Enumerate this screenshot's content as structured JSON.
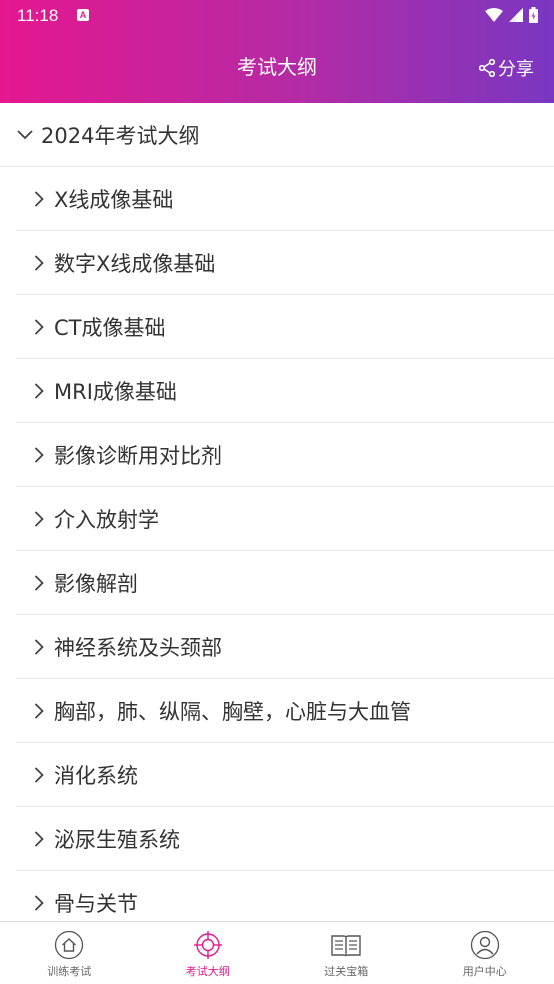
{
  "status": {
    "time": "11:18",
    "notif_icon": "A"
  },
  "header": {
    "title": "考试大纲",
    "share_label": "分享"
  },
  "section": {
    "title": "2024年考试大纲"
  },
  "items": [
    {
      "label": "X线成像基础"
    },
    {
      "label": "数字X线成像基础"
    },
    {
      "label": "CT成像基础"
    },
    {
      "label": "MRI成像基础"
    },
    {
      "label": "影像诊断用对比剂"
    },
    {
      "label": "介入放射学"
    },
    {
      "label": "影像解剖"
    },
    {
      "label": "神经系统及头颈部"
    },
    {
      "label": "胸部，肺、纵隔、胸壁，心脏与大血管"
    },
    {
      "label": "消化系统"
    },
    {
      "label": "泌尿生殖系统"
    },
    {
      "label": "骨与关节"
    }
  ],
  "nav": [
    {
      "label": "训练考试",
      "icon": "home-icon"
    },
    {
      "label": "考试大纲",
      "icon": "target-icon",
      "active": true
    },
    {
      "label": "过关宝箱",
      "icon": "book-icon"
    },
    {
      "label": "用户中心",
      "icon": "user-icon"
    }
  ],
  "colors": {
    "gradient_start": "#e5178f",
    "gradient_end": "#7937c1",
    "active": "#e5178f"
  }
}
